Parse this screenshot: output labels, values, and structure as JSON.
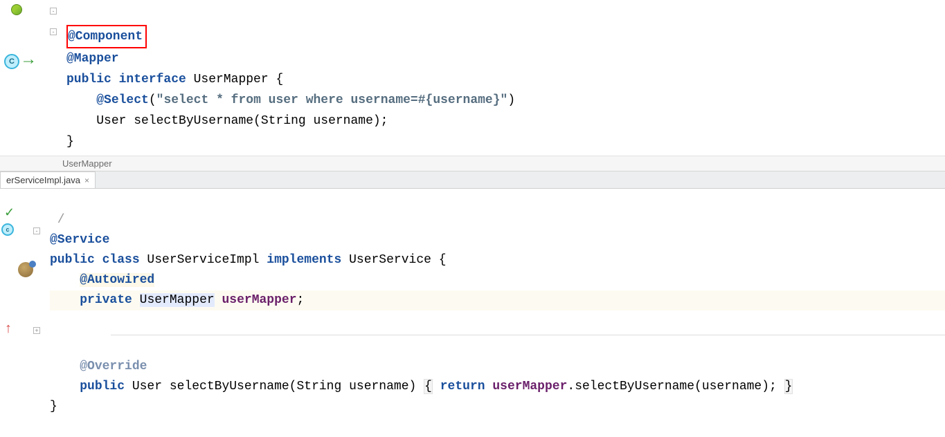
{
  "top": {
    "breadcrumb": "UserMapper",
    "lines": {
      "l1_annotation": "@Component",
      "l2_annotation": "@Mapper",
      "l3_keywords": "public interface",
      "l3_ident": " UserMapper {",
      "l4_indent": "    ",
      "l4_annotation": "@Select",
      "l4_paren_open": "(",
      "l4_string": "\"select * from user where username=#{username}\"",
      "l4_paren_close": ")",
      "l5_indent": "    ",
      "l5_code": "User selectByUsername(String username);",
      "l6_brace": "}"
    }
  },
  "tab": {
    "label": "erServiceImpl.java"
  },
  "bottom": {
    "lines": {
      "l1_annotation": "@Service",
      "l2_kw1": "public class",
      "l2_ident1": " UserServiceImpl ",
      "l2_kw2": "implements",
      "l2_ident2": " UserService {",
      "l3_indent": "    ",
      "l3_annotation": "@Autowired",
      "l4_indent": "    ",
      "l4_kw": "private",
      "l4_space1": " ",
      "l4_type": "UserMapper",
      "l4_space2": " ",
      "l4_field": "userMapper",
      "l4_semi": ";",
      "l5_blank": "",
      "l6_indent": "    ",
      "l6_annotation": "@Override",
      "l7_indent": "    ",
      "l7_kw": "public",
      "l7_rest1": " User selectByUsername(String username) ",
      "l7_brace_open": "{",
      "l7_space": " ",
      "l7_ret": "return",
      "l7_space2": " ",
      "l7_fieldref": "userMapper",
      "l7_rest2": ".selectByUsername(username); ",
      "l7_brace_close": "}",
      "l8_brace": "}"
    }
  }
}
